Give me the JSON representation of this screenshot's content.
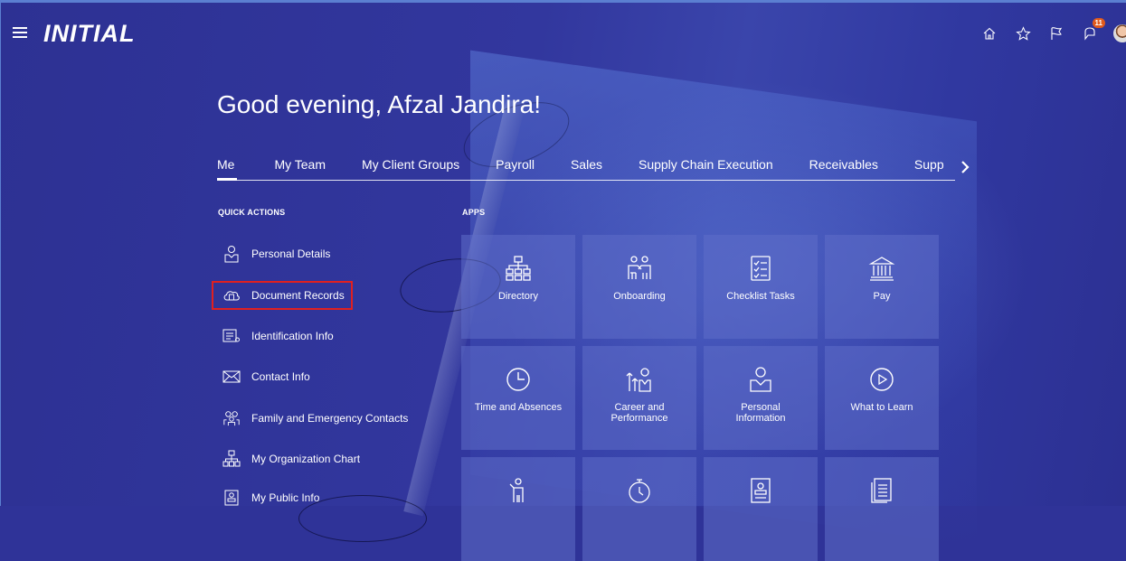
{
  "app": {
    "logo": "INITIAL"
  },
  "topbar": {
    "icons": [
      "home-icon",
      "star-icon",
      "flag-icon",
      "notifications-icon"
    ],
    "notification_count": "11"
  },
  "greeting": "Good evening, Afzal Jandira!",
  "tabs": [
    "Me",
    "My Team",
    "My Client Groups",
    "Payroll",
    "Sales",
    "Supply Chain Execution",
    "Receivables",
    "Supp"
  ],
  "sections": {
    "quick_actions": "QUICK ACTIONS",
    "apps": "APPS"
  },
  "quick_actions": [
    {
      "label": "Personal Details",
      "icon": "person-icon"
    },
    {
      "label": "Document Records",
      "icon": "cloud-document-icon"
    },
    {
      "label": "Identification Info",
      "icon": "id-card-icon"
    },
    {
      "label": "Contact Info",
      "icon": "envelope-icon"
    },
    {
      "label": "Family and Emergency Contacts",
      "icon": "family-icon"
    },
    {
      "label": "My Organization Chart",
      "icon": "org-chart-icon"
    },
    {
      "label": "My Public Info",
      "icon": "profile-card-icon"
    }
  ],
  "apps": [
    {
      "label": "Directory",
      "icon": "directory-icon"
    },
    {
      "label": "Onboarding",
      "icon": "onboarding-icon"
    },
    {
      "label": "Checklist Tasks",
      "icon": "checklist-icon"
    },
    {
      "label": "Pay",
      "icon": "bank-icon"
    },
    {
      "label": "Time and Absences",
      "icon": "clock-icon"
    },
    {
      "label": "Career and Performance",
      "icon": "career-icon"
    },
    {
      "label": "Personal Information",
      "icon": "person-icon"
    },
    {
      "label": "What to Learn",
      "icon": "play-icon"
    },
    {
      "label": "",
      "icon": "goal-icon"
    },
    {
      "label": "",
      "icon": "stopwatch-icon"
    },
    {
      "label": "",
      "icon": "badge-icon"
    },
    {
      "label": "",
      "icon": "document-icon"
    }
  ]
}
